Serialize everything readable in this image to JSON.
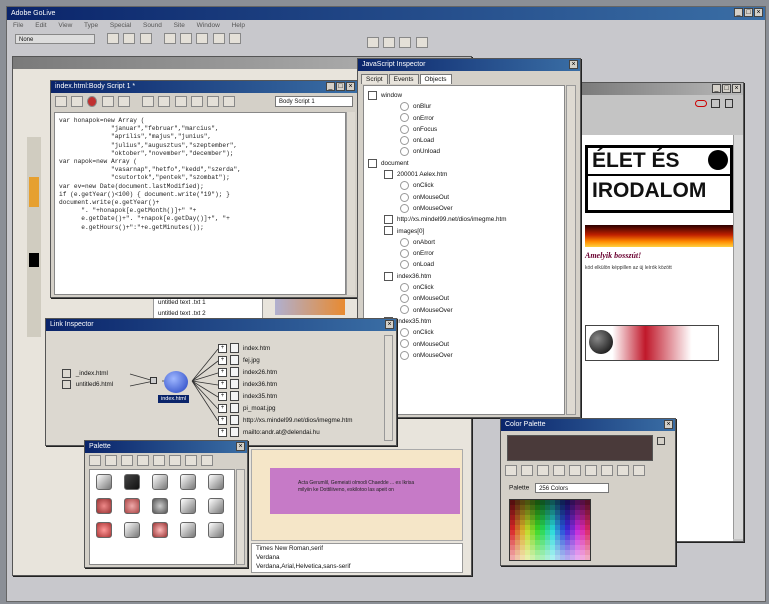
{
  "app": {
    "title": "Adobe GoLive",
    "menu": [
      "File",
      "Edit",
      "View",
      "Type",
      "Special",
      "Sound",
      "Site",
      "Window",
      "Help"
    ],
    "toolbar_dropdown": "None"
  },
  "script_window": {
    "title": "index.html:Body Script 1 *",
    "dropdown": "Body Script 1",
    "code": "var honapok=new Array (\n              \"januar\",\"februar\",\"marcius\",\n              \"aprilis\",\"majus\",\"junius\",\n              \"julius\",\"augusztus\",\"szeptember\",\n              \"oktober\",\"november\",\"december\");\nvar napok=new Array (\n              \"vasarnap\",\"hetfo\",\"kedd\",\"szerda\",\n              \"csutortok\",\"pentek\",\"szombat\");\nvar ev=new Date(document.lastModified);\nif (e.getYear()<100) { document.write(\"19\"); }\ndocument.write(e.getYear()+\n      \". \"+honapok[e.getMonth()]+\" \"+\n      e.getDate()+\". \"+napok[e.getDay()]+\", \"+\n      e.getHours()+\":\"+e.getMinutes());"
  },
  "js_inspector": {
    "title": "JavaScript Inspector",
    "tabs": [
      "Script",
      "Events",
      "Objects"
    ],
    "tree": [
      {
        "label": "window",
        "level": 0
      },
      {
        "label": "onBlur",
        "level": 2
      },
      {
        "label": "onError",
        "level": 2
      },
      {
        "label": "onFocus",
        "level": 2
      },
      {
        "label": "onLoad",
        "level": 2
      },
      {
        "label": "onUnload",
        "level": 2
      },
      {
        "label": "document",
        "level": 0
      },
      {
        "label": "200001 Aelex.htm",
        "level": 1
      },
      {
        "label": "onClick",
        "level": 2
      },
      {
        "label": "onMouseOut",
        "level": 2
      },
      {
        "label": "onMouseOver",
        "level": 2
      },
      {
        "label": "http://xs.mindel99.net/dios/imegme.htm",
        "level": 1
      },
      {
        "label": "images[0]",
        "level": 1
      },
      {
        "label": "onAbort",
        "level": 2
      },
      {
        "label": "onError",
        "level": 2
      },
      {
        "label": "onLoad",
        "level": 2
      },
      {
        "label": "index36.htm",
        "level": 1
      },
      {
        "label": "onClick",
        "level": 2
      },
      {
        "label": "onMouseOut",
        "level": 2
      },
      {
        "label": "onMouseOver",
        "level": 2
      },
      {
        "label": "index35.htm",
        "level": 1
      },
      {
        "label": "onClick",
        "level": 2
      },
      {
        "label": "onMouseOut",
        "level": 2
      },
      {
        "label": "onMouseOver",
        "level": 2
      }
    ]
  },
  "link_inspector": {
    "title": "Link Inspector",
    "left_items": [
      "_index.html",
      "untitled6.html"
    ],
    "center_label": "index.html",
    "right_items": [
      "index.htm",
      "fej.jpg",
      "index26.htm",
      "index36.htm",
      "index35.htm",
      "pi_moat.jpg",
      "http://xs.mindel99.net/dios/imegme.htm",
      "mailto:andr.at@delendai.hu"
    ]
  },
  "palette": {
    "title": "Palette"
  },
  "color_palette": {
    "title": "Color Palette",
    "palette_label": "Palette",
    "palette_select": "256 Colors"
  },
  "site_list": {
    "rows": [
      "untitled text .txt 1",
      "untitled text .txt 2"
    ]
  },
  "font_list": {
    "items": [
      "Times New Roman,serif",
      "Verdana",
      "Verdana,Arial,Helvetica,sans-serif"
    ]
  },
  "preview": {
    "logo_line1": "ÉLET ÉS",
    "logo_line2": "IRODALOM",
    "headline": "Amelyik bosszút!",
    "subtext": "kód  elkülön képpillen  az  új  leírók  között"
  },
  "background_text": {
    "bottom_text": "Acta Gerumlil, Gemeiati olmodi Chaedde ... es Ikrisa\nmilyiin ke Dottiliiveno, eskilotoo las apeit on"
  },
  "colors": {
    "desktop": "#8b8f96",
    "titlebar": "#0a246a",
    "titlebar_end": "#3a6ea5",
    "chrome": "#d4d0c8"
  }
}
